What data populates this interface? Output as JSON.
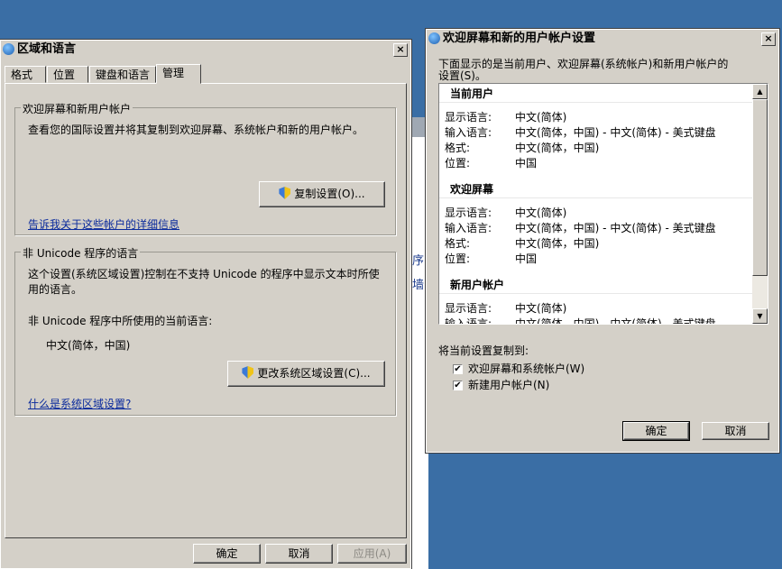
{
  "background_windows": {
    "frag1": "序",
    "frag2": "墙"
  },
  "region_dialog": {
    "title": "区域和语言",
    "close_label": "×",
    "tabs": [
      "格式",
      "位置",
      "键盘和语言",
      "管理"
    ],
    "active_tab": "管理",
    "welcome_group": {
      "legend": "欢迎屏幕和新用户帐户",
      "description": "查看您的国际设置并将其复制到欢迎屏幕、系统帐户和新的用户帐户。",
      "copy_button": "复制设置(O)...",
      "link": "告诉我关于这些帐户的详细信息"
    },
    "unicode_group": {
      "legend": "非 Unicode 程序的语言",
      "description_line1": "这个设置(系统区域设置)控制在不支持 Unicode 的程序中显示文本时所使",
      "description_line2": "用的语言。",
      "current_label": "非 Unicode 程序中所使用的当前语言:",
      "current_value": "中文(简体，中国)",
      "change_button": "更改系统区域设置(C)...",
      "link": "什么是系统区域设置?"
    },
    "ok_button": "确定",
    "cancel_button": "取消",
    "apply_button": "应用(A)"
  },
  "welcome_dialog": {
    "title": "欢迎屏幕和新的用户帐户设置",
    "close_label": "×",
    "intro_line1": "下面显示的是当前用户、欢迎屏幕(系统帐户)和新用户帐户的",
    "intro_line2": "设置(S)。",
    "sections": [
      {
        "heading": "当前用户",
        "rows": [
          {
            "label": "显示语言:",
            "value": "中文(简体)"
          },
          {
            "label": "输入语言:",
            "value": "中文(简体，中国) - 中文(简体) - 美式键盘"
          },
          {
            "label": "格式:",
            "value": "中文(简体，中国)"
          },
          {
            "label": "位置:",
            "value": "中国"
          }
        ]
      },
      {
        "heading": "欢迎屏幕",
        "rows": [
          {
            "label": "显示语言:",
            "value": "中文(简体)"
          },
          {
            "label": "输入语言:",
            "value": "中文(简体，中国) - 中文(简体) - 美式键盘"
          },
          {
            "label": "格式:",
            "value": "中文(简体，中国)"
          },
          {
            "label": "位置:",
            "value": "中国"
          }
        ]
      },
      {
        "heading": "新用户帐户",
        "rows": [
          {
            "label": "显示语言:",
            "value": "中文(简体)"
          },
          {
            "label": "输入语言:",
            "value": "中文(简体，中国) - 中文(简体) - 美式键盘"
          }
        ]
      }
    ],
    "copy_to_label": "将当前设置复制到:",
    "checkbox1_label": "欢迎屏幕和系统帐户(W)",
    "checkbox1_checked": true,
    "checkbox2_label": "新建用户帐户(N)",
    "checkbox2_checked": true,
    "check_mark": "✔",
    "ok_button": "确定",
    "cancel_button": "取消"
  }
}
